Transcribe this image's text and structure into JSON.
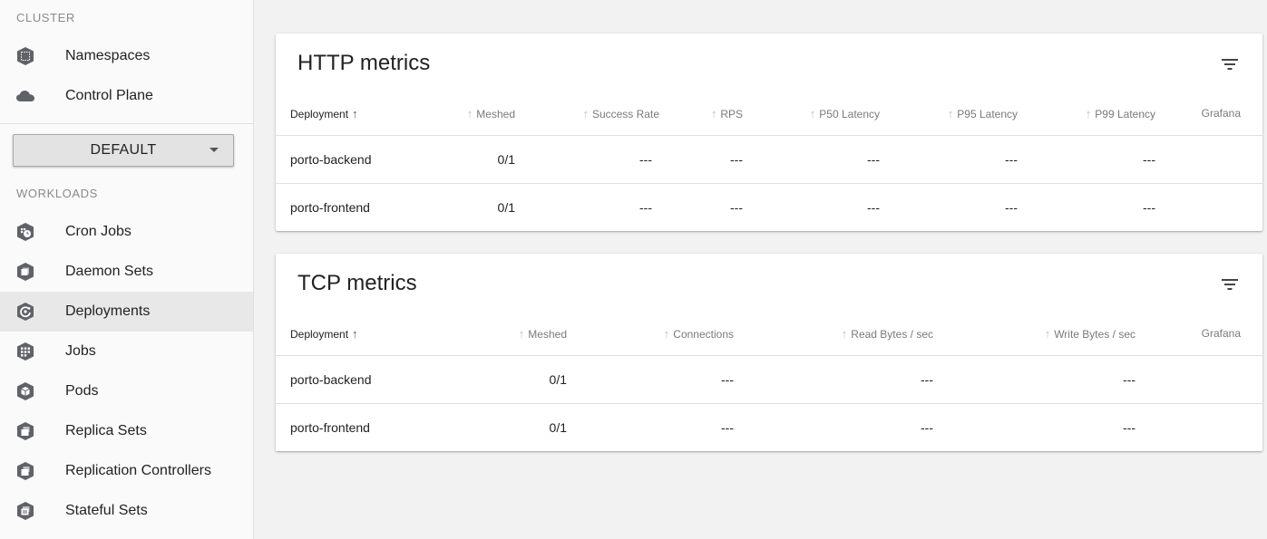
{
  "sidebar": {
    "cluster_label": "CLUSTER",
    "cluster_items": [
      {
        "label": "Namespaces",
        "icon": "namespace-icon"
      },
      {
        "label": "Control Plane",
        "icon": "cloud-icon"
      }
    ],
    "namespace_select": {
      "value": "DEFAULT"
    },
    "workloads_label": "WORKLOADS",
    "workload_items": [
      {
        "label": "Cron Jobs",
        "icon": "cronjob-icon"
      },
      {
        "label": "Daemon Sets",
        "icon": "daemonset-icon"
      },
      {
        "label": "Deployments",
        "icon": "deployment-icon",
        "active": true
      },
      {
        "label": "Jobs",
        "icon": "job-icon"
      },
      {
        "label": "Pods",
        "icon": "pod-icon"
      },
      {
        "label": "Replica Sets",
        "icon": "replicaset-icon"
      },
      {
        "label": "Replication Controllers",
        "icon": "replicationcontroller-icon"
      },
      {
        "label": "Stateful Sets",
        "icon": "statefulset-icon"
      }
    ]
  },
  "http": {
    "title": "HTTP metrics",
    "columns": [
      "Deployment",
      "Meshed",
      "Success Rate",
      "RPS",
      "P50 Latency",
      "P95 Latency",
      "P99 Latency",
      "Grafana"
    ],
    "rows": [
      {
        "deployment": "porto-backend",
        "meshed": "0/1",
        "success_rate": "---",
        "rps": "---",
        "p50": "---",
        "p95": "---",
        "p99": "---",
        "grafana": ""
      },
      {
        "deployment": "porto-frontend",
        "meshed": "0/1",
        "success_rate": "---",
        "rps": "---",
        "p50": "---",
        "p95": "---",
        "p99": "---",
        "grafana": ""
      }
    ]
  },
  "tcp": {
    "title": "TCP metrics",
    "columns": [
      "Deployment",
      "Meshed",
      "Connections",
      "Read Bytes / sec",
      "Write Bytes / sec",
      "Grafana"
    ],
    "rows": [
      {
        "deployment": "porto-backend",
        "meshed": "0/1",
        "connections": "---",
        "read": "---",
        "write": "---",
        "grafana": ""
      },
      {
        "deployment": "porto-frontend",
        "meshed": "0/1",
        "connections": "---",
        "read": "---",
        "write": "---",
        "grafana": ""
      }
    ]
  },
  "colors": {
    "accent_icon": "#5f6368",
    "active_bg": "#e8e8e8"
  },
  "sort_arrow": "↑"
}
